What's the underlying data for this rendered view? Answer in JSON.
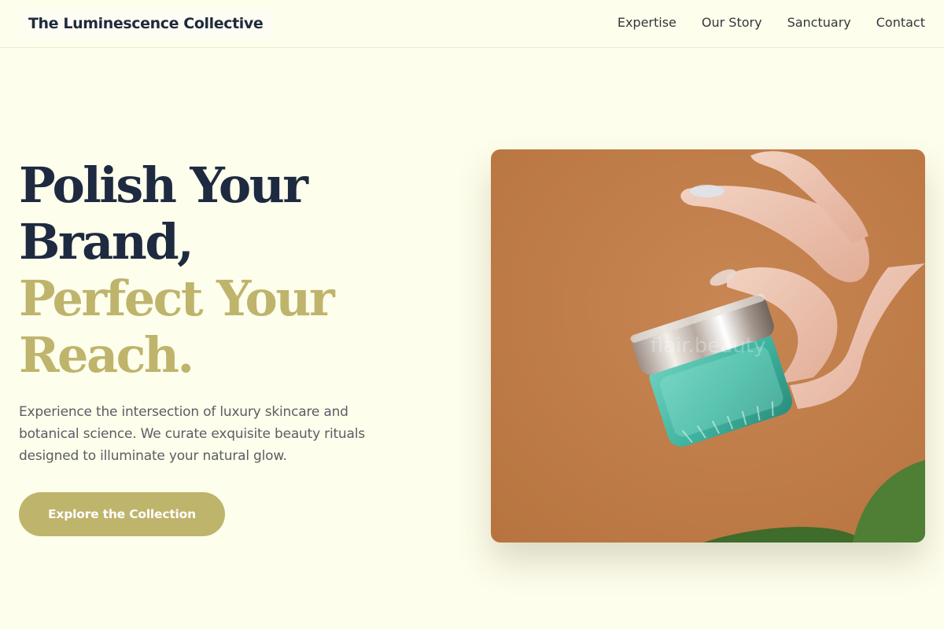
{
  "header": {
    "brand": "The Luminescence Collective",
    "nav": [
      "Expertise",
      "Our Story",
      "Sanctuary",
      "Contact"
    ]
  },
  "hero": {
    "title_line1": "Polish Your",
    "title_line2": "Brand,",
    "title_line3": "Perfect Your",
    "title_line4": "Reach.",
    "description": "Experience the intersection of luxury skincare and botanical science. We curate exquisite beauty rituals designed to illuminate your natural glow.",
    "cta_label": "Explore the Collection",
    "image_watermark": "flair.beauty"
  },
  "colors": {
    "background": "#fefeec",
    "navy": "#1d2a40",
    "gold": "#bfb46c",
    "image_bg": "#c27f4c"
  }
}
